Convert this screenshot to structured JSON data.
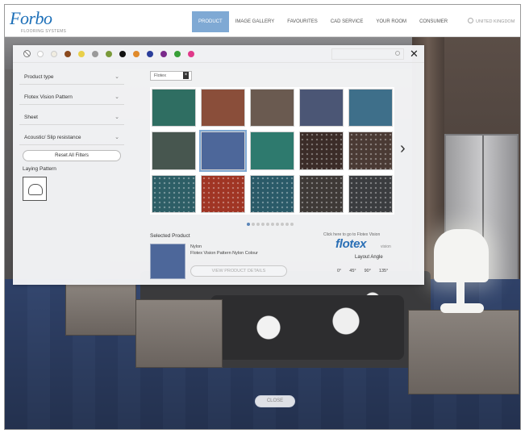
{
  "brand": {
    "logo": "Forbo",
    "tagline": "FLOORING SYSTEMS"
  },
  "nav": {
    "items": [
      "PRODUCT",
      "IMAGE GALLERY",
      "FAVOURITES",
      "CAD SERVICE",
      "YOUR ROOM",
      "CONSUMER"
    ],
    "active_index": 0,
    "language": "UNITED KINGDOM"
  },
  "color_filter": {
    "swatches": [
      "#ffffff",
      "#f1ede1",
      "#8b4a1e",
      "#e9d04a",
      "#9a9a9a",
      "#7a9a3a",
      "#111111",
      "#e08a2a",
      "#2b3f9b",
      "#7a2a8a",
      "#38a038",
      "#e03a8a"
    ],
    "search_placeholder": "",
    "icons": {
      "reset": "no-color-icon",
      "search": "search-icon",
      "close": "close-icon"
    }
  },
  "filters": {
    "items": [
      "Product type",
      "Flotex Vision Pattern",
      "Sheet",
      "Acoustic/ Slip resistance"
    ],
    "reset_label": "Reset All Filters",
    "laying_label": "Laying Pattern",
    "laying_icon": "laying-pattern-icon"
  },
  "product_tab": {
    "label": "Flotex"
  },
  "products": [
    {
      "color": "#2f6e62",
      "pattern": "plain"
    },
    {
      "color": "#8a4e3a",
      "pattern": "plain"
    },
    {
      "color": "#6a5a50",
      "pattern": "plain"
    },
    {
      "color": "#4b5675",
      "pattern": "plain"
    },
    {
      "color": "#3e6f8a",
      "pattern": "plain"
    },
    {
      "color": "#47564f",
      "pattern": "plain"
    },
    {
      "color": "#4d679a",
      "pattern": "plain"
    },
    {
      "color": "#2e7a6e",
      "pattern": "plain"
    },
    {
      "color": "#3b2c28",
      "pattern": "dots"
    },
    {
      "color": "#4a3a34",
      "pattern": "dots"
    },
    {
      "color": "#2d5e66",
      "pattern": "dots"
    },
    {
      "color": "#a03524",
      "pattern": "dots"
    },
    {
      "color": "#2a5a68",
      "pattern": "dots"
    },
    {
      "color": "#3e3936",
      "pattern": "dots"
    },
    {
      "color": "#3a3c3f",
      "pattern": "dots"
    }
  ],
  "active_product_index": 6,
  "pagination": {
    "pages": 10,
    "current": 1
  },
  "selected": {
    "label": "Selected Product",
    "color": "#4d679a",
    "name": "Nylon",
    "description": "Flotex Vision Pattern Nylon Colour",
    "action": "VIEW PRODUCT DETAILS"
  },
  "brand_panel": {
    "caption": "Click here to go to Flotex Vision",
    "logo": "flotex",
    "logo_sub": "vision",
    "angle_label": "Layout Angle",
    "angles": [
      "0°",
      "45°",
      "90°",
      "135°"
    ]
  },
  "footer": {
    "close_label": "CLOSE"
  }
}
